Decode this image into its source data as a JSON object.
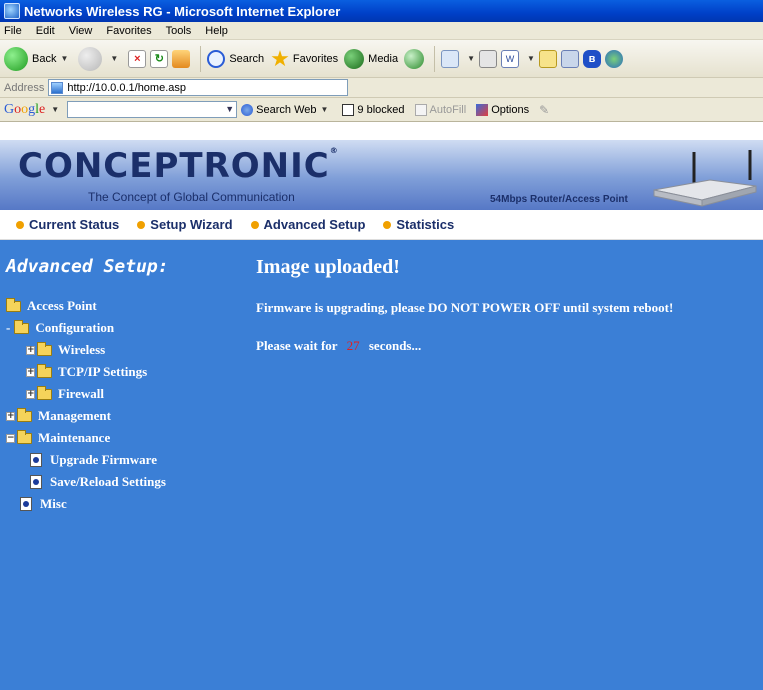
{
  "window": {
    "title": "Networks Wireless RG - Microsoft Internet Explorer"
  },
  "menu": [
    "File",
    "Edit",
    "View",
    "Favorites",
    "Tools",
    "Help"
  ],
  "toolbar": {
    "back_label": "Back",
    "search_label": "Search",
    "favorites_label": "Favorites",
    "media_label": "Media"
  },
  "address": {
    "label": "Address",
    "url": "http://10.0.0.1/home.asp"
  },
  "google_bar": {
    "search_web_label": "Search Web",
    "blocked_label": "9 blocked",
    "autofill_label": "AutoFill",
    "options_label": "Options"
  },
  "router": {
    "brand": "CONCEPTRONIC",
    "registered": "®",
    "tagline": "The Concept of Global Communication",
    "model": "54Mbps Router/Access Point",
    "nav": [
      "Current Status",
      "Setup Wizard",
      "Advanced Setup",
      "Statistics"
    ],
    "sidebar_title": "Advanced Setup:",
    "tree": {
      "access_point": "Access Point",
      "configuration": "Configuration",
      "wireless": "Wireless",
      "tcpip": "TCP/IP Settings",
      "firewall": "Firewall",
      "management": "Management",
      "maintenance": "Maintenance",
      "upgrade_firmware": "Upgrade Firmware",
      "save_reload": "Save/Reload Settings",
      "misc": "Misc"
    },
    "main_title": "Image uploaded!",
    "message": "Firmware is upgrading, please DO NOT POWER OFF until system reboot!",
    "wait_prefix": "Please wait for",
    "countdown": "27",
    "wait_suffix": "seconds..."
  },
  "colors": {
    "content_bg": "#3b7fd6",
    "countdown": "#e02020",
    "nav_bullet": "#f0a000",
    "brand_text": "#1b2f6a"
  }
}
